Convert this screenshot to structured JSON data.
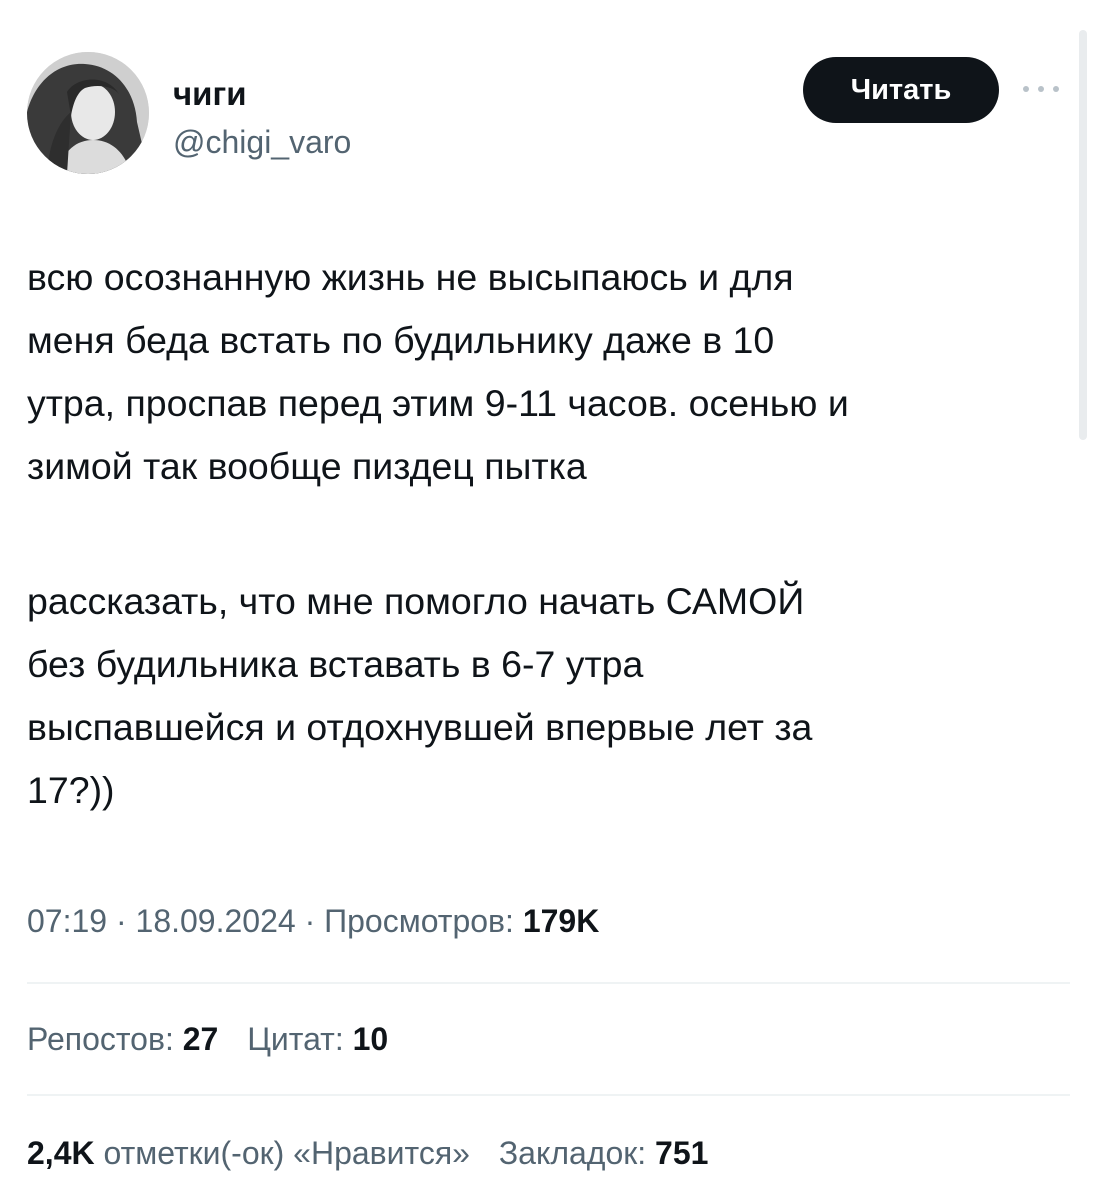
{
  "author": {
    "display_name": "чиги",
    "handle": "@chigi_varo",
    "avatar_icon": "profile-photo"
  },
  "header": {
    "follow_label": "Читать",
    "more_icon": "more-icon"
  },
  "tweet": {
    "paragraph_1": "всю осознанную жизнь не высыпаюсь и для\nменя беда встать по будильнику даже в 10\nутра, проспав перед этим 9-11 часов. осенью и\nзимой так вообще пиздец пытка",
    "paragraph_2": "рассказать, что мне помогло начать САМОЙ\nбез будильника вставать в 6-7 утра\nвыспавшейся и отдохнувшей впервые лет за\n17?))"
  },
  "meta": {
    "time": "07:19",
    "separator": " · ",
    "date": "18.09.2024",
    "views_label": "Просмотров:",
    "views_value": "179K"
  },
  "stats": {
    "reposts_label": "Репостов:",
    "reposts_value": "27",
    "quotes_label": "Цитат:",
    "quotes_value": "10",
    "likes_value": "2,4K",
    "likes_label": "отметки(-ок) «Нравится»",
    "bookmarks_label": "Закладок:",
    "bookmarks_value": "751"
  },
  "colors": {
    "text_primary": "#0f1419",
    "text_secondary": "#536471",
    "button_bg": "#0f1419",
    "divider": "#eff3f4"
  }
}
